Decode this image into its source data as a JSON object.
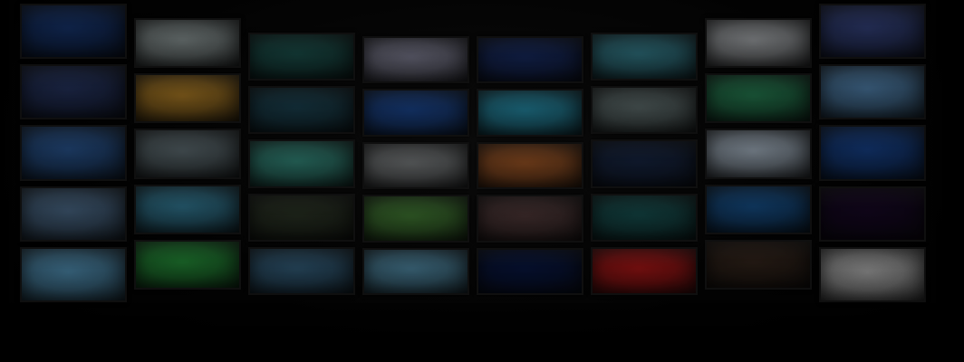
{
  "wall": {
    "columns": 8,
    "rows": 5,
    "colors": [
      [
        "#1a3b7a",
        "#2a3a6a",
        "#2e5fa0",
        "#557799",
        "#5aa0c8"
      ],
      [
        "#9aa6a6",
        "#c08a2a",
        "#6a7a80",
        "#3a8aa8",
        "#2aa040"
      ],
      [
        "#1f5a55",
        "#1f4a5a",
        "#3a9a8a",
        "#303a2a",
        "#3a6a8a"
      ],
      [
        "#8a8aa0",
        "#1f4fa0",
        "#8a8e90",
        "#4a8a3a",
        "#5a9ab8"
      ],
      [
        "#1a2f6a",
        "#2a9ab8",
        "#b0602a",
        "#5a4040",
        "#0a1a4a"
      ],
      [
        "#3a8a9a",
        "#6a7a7a",
        "#1a2a4a",
        "#1a5a5a",
        "#c01a1a"
      ],
      [
        "#b8bcc0",
        "#2a8a5a",
        "#b8c8d8",
        "#1a5a9a",
        "#3a2a20"
      ],
      [
        "#3a4a8a",
        "#5a90c0",
        "#1a4a9a",
        "#1a0a2a",
        "#c8c8c8"
      ]
    ]
  }
}
